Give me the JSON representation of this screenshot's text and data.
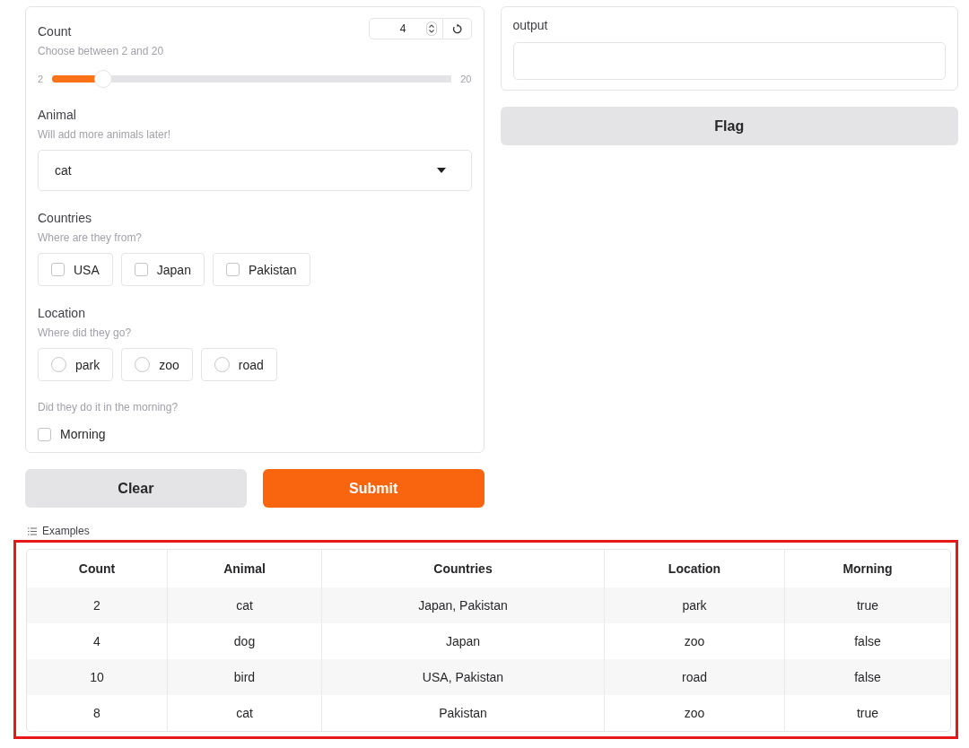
{
  "count": {
    "label": "Count",
    "hint": "Choose between 2 and 20",
    "value": "4",
    "min_label": "2",
    "max_label": "20",
    "level": 0.11
  },
  "animal": {
    "label": "Animal",
    "hint": "Will add more animals later!",
    "value": "cat"
  },
  "countries": {
    "label": "Countries",
    "hint": "Where are they from?",
    "options": [
      {
        "label": "USA",
        "checked": false
      },
      {
        "label": "Japan",
        "checked": false
      },
      {
        "label": "Pakistan",
        "checked": false
      }
    ]
  },
  "location": {
    "label": "Location",
    "hint": "Where did they go?",
    "options": [
      {
        "label": "park",
        "selected": false
      },
      {
        "label": "zoo",
        "selected": false
      },
      {
        "label": "road",
        "selected": false
      }
    ]
  },
  "morning": {
    "hint": "Did they do it in the morning?",
    "label": "Morning",
    "checked": false
  },
  "buttons": [
    {
      "label": "Clear",
      "kind": "secondary"
    },
    {
      "label": "Submit",
      "kind": "primary"
    }
  ],
  "output": {
    "label": "output"
  },
  "flag_button": {
    "label": "Flag"
  },
  "examples": {
    "title": "Examples",
    "columns": [
      "Count",
      "Animal",
      "Countries",
      "Location",
      "Morning"
    ],
    "rows": [
      [
        "2",
        "cat",
        "Japan, Pakistan",
        "park",
        "true"
      ],
      [
        "4",
        "dog",
        "Japan",
        "zoo",
        "false"
      ],
      [
        "10",
        "bird",
        "USA, Pakistan",
        "road",
        "false"
      ],
      [
        "8",
        "cat",
        "Pakistan",
        "zoo",
        "true"
      ]
    ]
  }
}
